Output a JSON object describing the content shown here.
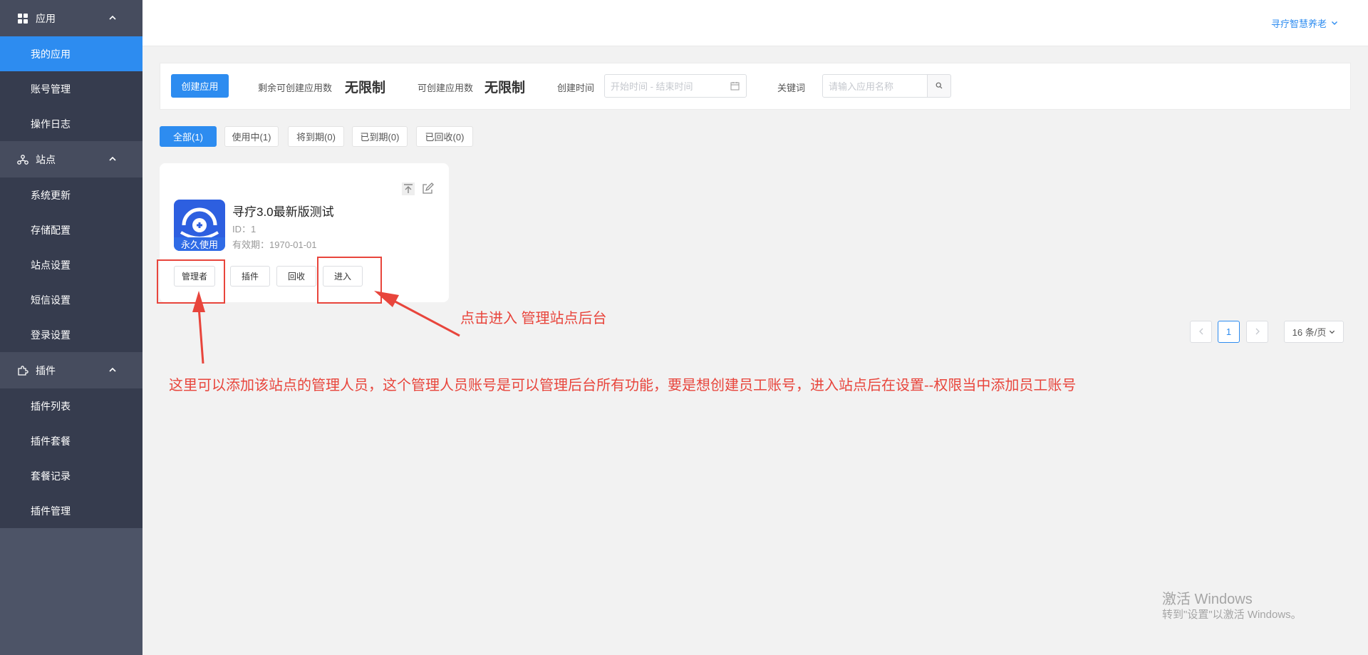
{
  "sidebar": {
    "groups": [
      {
        "label": "应用",
        "icon": "apps-grid-icon",
        "items": [
          {
            "label": "我的应用",
            "active": true
          },
          {
            "label": "账号管理"
          },
          {
            "label": "操作日志"
          }
        ]
      },
      {
        "label": "站点",
        "icon": "sitemap-icon",
        "items": [
          {
            "label": "系统更新"
          },
          {
            "label": "存储配置"
          },
          {
            "label": "站点设置"
          },
          {
            "label": "短信设置"
          },
          {
            "label": "登录设置"
          }
        ]
      },
      {
        "label": "插件",
        "icon": "puzzle-plugin-icon",
        "items": [
          {
            "label": "插件列表"
          },
          {
            "label": "插件套餐"
          },
          {
            "label": "套餐记录"
          },
          {
            "label": "插件管理"
          }
        ]
      }
    ]
  },
  "header": {
    "user_name": "寻疗智慧养老"
  },
  "filter": {
    "create_button": "创建应用",
    "remaining_label": "剩余可创建应用数",
    "remaining_value": "无限制",
    "creatable_label": "可创建应用数",
    "creatable_value": "无限制",
    "time_label": "创建时间",
    "time_placeholder": "开始时间 - 结束时间",
    "keyword_label": "关键词",
    "keyword_placeholder": "请输入应用名称"
  },
  "tabs": [
    "全部(1)",
    "使用中(1)",
    "将到期(0)",
    "已到期(0)",
    "已回收(0)"
  ],
  "card": {
    "badge": "永久使用",
    "title": "寻疗3.0最新版测试",
    "id_text": "ID：1",
    "expiry_text": "有效期：1970-01-01",
    "buttons": [
      "管理者",
      "插件",
      "回收",
      "进入"
    ]
  },
  "pagination": {
    "current_page": "1",
    "page_size": "16 条/页"
  },
  "annotations": {
    "enter_note": "点击进入 管理站点后台",
    "manager_note": "这里可以添加该站点的管理人员，这个管理人员账号是可以管理后台所有功能，要是想创建员工账号，进入站点后在设置--权限当中添加员工账号",
    "color": "#e8453c"
  },
  "watermark": {
    "line1": "激活 Windows",
    "line2": "转到\"设置\"以激活 Windows。"
  },
  "colors": {
    "primary": "#2d8cf0",
    "sidebar": "#363c4e",
    "sidebar_head": "#464c5e"
  }
}
